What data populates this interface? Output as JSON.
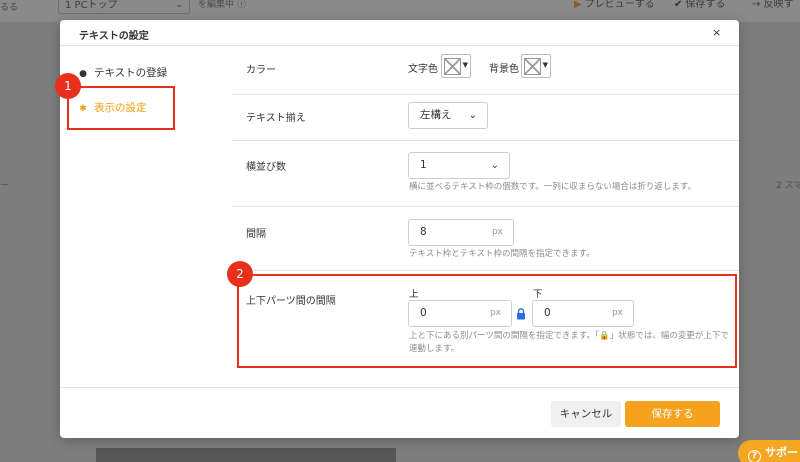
{
  "background": {
    "left_text": "るる",
    "page_select": "1 PCトップ",
    "edit_text": "を編集中 ⓘ",
    "preview": "プレビューする",
    "save": "保存する",
    "reflect": "反映す",
    "side_left": "ー",
    "side_right": "2 スマ",
    "support": "サポート"
  },
  "modal": {
    "title": "テキストの設定",
    "close": "×"
  },
  "sidebar": {
    "items": [
      {
        "label": "テキストの登録",
        "icon": "speech-bubble-icon"
      },
      {
        "label": "表示の設定",
        "icon": "gear-icon",
        "active": true
      }
    ]
  },
  "form": {
    "color": {
      "label": "カラー",
      "text_color_label": "文字色",
      "bg_color_label": "背景色"
    },
    "align": {
      "label": "テキスト揃え",
      "value": "左構え"
    },
    "columns": {
      "label": "横並び数",
      "value": "1",
      "help": "横に並べるテキスト枠の個数です。一列に収まらない場合は折り返します。"
    },
    "spacing": {
      "label": "間隔",
      "value": "8",
      "unit": "px",
      "help": "テキスト枠とテキスト枠の間隔を指定できます。"
    },
    "parts_spacing": {
      "label": "上下パーツ間の間隔",
      "top_label": "上",
      "top_value": "0",
      "bottom_label": "下",
      "bottom_value": "0",
      "unit": "px",
      "help_line1": "上と下にある別パーツ間の間隔を指定できます。「🔒」状態では、幅の変更が上下で",
      "help_line2": "連動します。"
    }
  },
  "footer": {
    "cancel": "キャンセル",
    "save": "保存する"
  },
  "annotations": {
    "badge1": "1",
    "badge2": "2"
  },
  "colors": {
    "accent": "#f5a21f",
    "annotation_red": "#e8301c",
    "lock_blue": "#2b6de8"
  }
}
